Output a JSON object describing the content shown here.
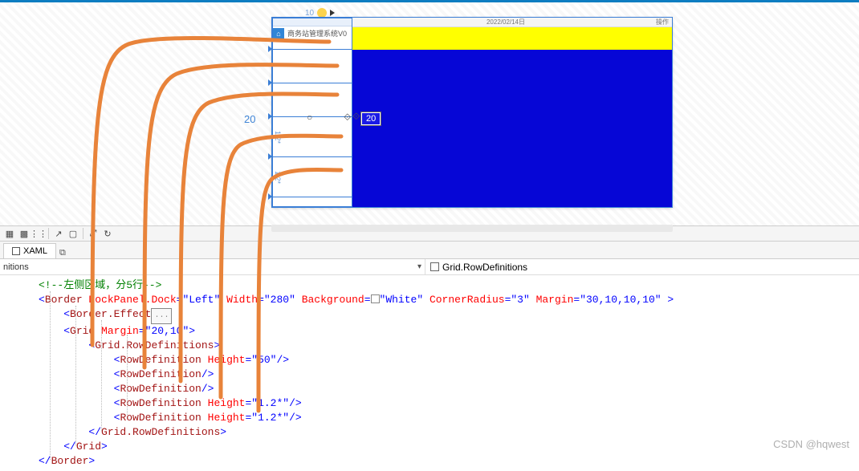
{
  "designer": {
    "ruler_num": "10",
    "left_panel_title": "商务站管理系统V0",
    "side_number": "20",
    "center_number": "20",
    "row_labels": [
      "1.2*",
      "1.2*"
    ],
    "preview_header_left": "",
    "preview_header_date": "2022/02/14日",
    "preview_header_right": "操作"
  },
  "tabs": {
    "xaml": "XAML"
  },
  "breadcrumb": {
    "left": "nitions",
    "right": "Grid.RowDefinitions"
  },
  "code": {
    "l1_comment": "<!--左侧区域，分5行-->",
    "l2_a": "<",
    "l2_b": "Border",
    "l2_c": " DockPanel.Dock",
    "l2_d": "=\"Left\"",
    "l2_e": " Width",
    "l2_f": "=\"280\"",
    "l2_g": " Background",
    "l2_h": "=",
    "l2_i": "\"White\"",
    "l2_j": " CornerRadius",
    "l2_k": "=\"3\"",
    "l2_l": " Margin",
    "l2_m": "=\"30,10,10,10\"",
    "l2_n": " >",
    "l3_a": "<",
    "l3_b": "Border.Effect",
    "l3_c": "...",
    "l4_a": "<",
    "l4_b": "Grid",
    "l4_c": " Margin",
    "l4_d": "=\"20,10\"",
    "l4_e": ">",
    "l5_a": "<",
    "l5_b": "Grid.RowDefinitions",
    "l5_c": ">",
    "l6_a": "<",
    "l6_b": "RowDefinition",
    "l6_c": " Height",
    "l6_d": "=\"50\"",
    "l6_e": "/>",
    "l7_a": "<",
    "l7_b": "RowDefinition",
    "l7_c": "/>",
    "l8_a": "<",
    "l8_b": "RowDefinition",
    "l8_c": "/>",
    "l9_a": "<",
    "l9_b": "RowDefinition",
    "l9_c": " Height",
    "l9_d": "=\"1.2*\"",
    "l9_e": "/>",
    "l10_a": "<",
    "l10_b": "RowDefinition",
    "l10_c": " Height",
    "l10_d": "=\"1.2*\"",
    "l10_e": "/>",
    "l11_a": "</",
    "l11_b": "Grid.RowDefinitions",
    "l11_c": ">",
    "l12_a": "</",
    "l12_b": "Grid",
    "l12_c": ">",
    "l13_a": "</",
    "l13_b": "Border",
    "l13_c": ">"
  },
  "watermark": "CSDN @hqwest"
}
